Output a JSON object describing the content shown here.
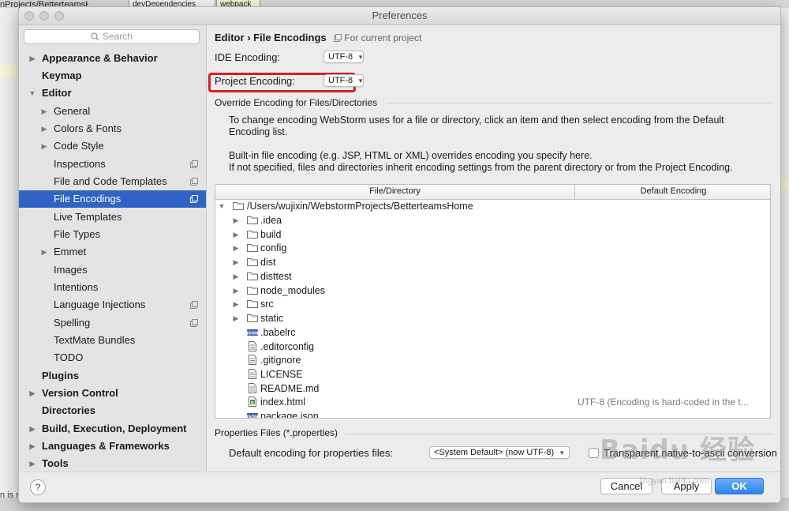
{
  "background": {
    "frag_project": "nProjects/BetterteamsH",
    "chip_dev": "devDependencies",
    "chip_webpack": "webpack",
    "bottom_text": "n is r"
  },
  "window": {
    "title": "Preferences"
  },
  "search": {
    "placeholder": "Search"
  },
  "sidebar": {
    "items": [
      {
        "label": "Appearance & Behavior"
      },
      {
        "label": "Keymap"
      },
      {
        "label": "Editor"
      },
      {
        "label": "General"
      },
      {
        "label": "Colors & Fonts"
      },
      {
        "label": "Code Style"
      },
      {
        "label": "Inspections"
      },
      {
        "label": "File and Code Templates"
      },
      {
        "label": "File Encodings"
      },
      {
        "label": "Live Templates"
      },
      {
        "label": "File Types"
      },
      {
        "label": "Emmet"
      },
      {
        "label": "Images"
      },
      {
        "label": "Intentions"
      },
      {
        "label": "Language Injections"
      },
      {
        "label": "Spelling"
      },
      {
        "label": "TextMate Bundles"
      },
      {
        "label": "TODO"
      },
      {
        "label": "Plugins"
      },
      {
        "label": "Version Control"
      },
      {
        "label": "Directories"
      },
      {
        "label": "Build, Execution, Deployment"
      },
      {
        "label": "Languages & Frameworks"
      },
      {
        "label": "Tools"
      }
    ]
  },
  "main": {
    "breadcrumb_parent": "Editor",
    "breadcrumb_sep": "›",
    "breadcrumb_current": "File Encodings",
    "scope": "For current project",
    "ide_encoding_label": "IDE Encoding:",
    "ide_encoding_value": "UTF-8",
    "project_encoding_label": "Project Encoding:",
    "project_encoding_value": "UTF-8",
    "override_title": "Override Encoding for Files/Directories",
    "para1_line1": "To change encoding WebStorm uses for a file or directory, click an item and then select encoding from the Default",
    "para1_line2": "Encoding list.",
    "para2_line1": "Built-in file encoding (e.g. JSP, HTML or XML) overrides encoding you specify here.",
    "para2_line2": "If not specified, files and directories inherit encoding settings from the parent directory or from the Project Encoding.",
    "table": {
      "col_file": "File/Directory",
      "col_encoding": "Default Encoding",
      "root": "/Users/wujixin/WebstormProjects/BetterteamsHome",
      "rows": [
        {
          "name": ".idea",
          "type": "folder",
          "encoding": ""
        },
        {
          "name": "build",
          "type": "folder",
          "encoding": ""
        },
        {
          "name": "config",
          "type": "folder",
          "encoding": ""
        },
        {
          "name": "dist",
          "type": "folder",
          "encoding": ""
        },
        {
          "name": "disttest",
          "type": "folder",
          "encoding": ""
        },
        {
          "name": "node_modules",
          "type": "folder",
          "encoding": ""
        },
        {
          "name": "src",
          "type": "folder",
          "encoding": ""
        },
        {
          "name": "static",
          "type": "folder",
          "encoding": ""
        },
        {
          "name": ".babelrc",
          "type": "json",
          "encoding": ""
        },
        {
          "name": ".editorconfig",
          "type": "text",
          "encoding": ""
        },
        {
          "name": ".gitignore",
          "type": "text",
          "encoding": ""
        },
        {
          "name": "LICENSE",
          "type": "text",
          "encoding": ""
        },
        {
          "name": "README.md",
          "type": "text",
          "encoding": ""
        },
        {
          "name": "index.html",
          "type": "html",
          "encoding": "UTF-8 (Encoding is hard-coded in the t..."
        },
        {
          "name": "package.json",
          "type": "json",
          "encoding": ""
        }
      ]
    },
    "properties_title": "Properties Files (*.properties)",
    "properties_label": "Default encoding for properties files:",
    "properties_value": "<System Default> (now UTF-8)",
    "transparent_label": "Transparent native-to-ascii conversion"
  },
  "footer": {
    "help": "?",
    "cancel": "Cancel",
    "apply": "Apply",
    "ok": "OK"
  },
  "watermark": {
    "text": "Baidu 经验",
    "sub": "jingyan.baidu.com"
  }
}
